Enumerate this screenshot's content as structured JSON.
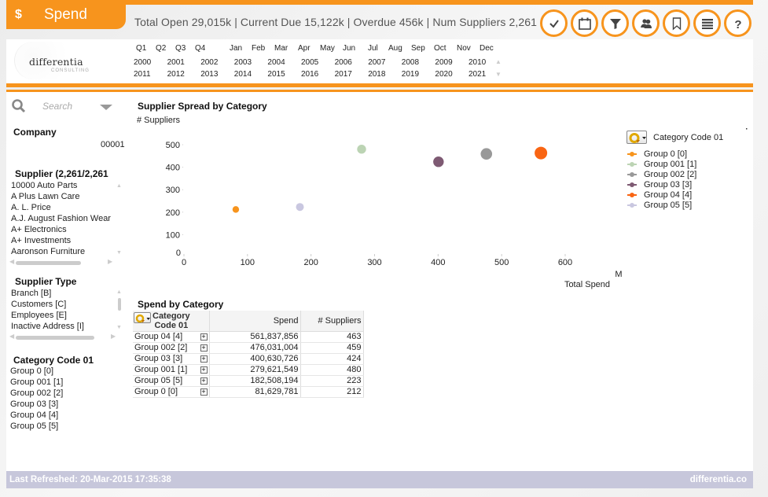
{
  "header": {
    "app_icon": "$",
    "app_title": "Spend",
    "kpi_text": "Total Open 29,015k | Current Due 15,122k | Overdue 456k | Num Suppliers 2,261",
    "toolbar": [
      {
        "icon": "check-icon",
        "label": "Confirm"
      },
      {
        "icon": "calendar-icon",
        "label": "Calendar"
      },
      {
        "icon": "filter-icon",
        "label": "Filter"
      },
      {
        "icon": "users-icon",
        "label": "Users"
      },
      {
        "icon": "bookmark-icon",
        "label": "Bookmark"
      },
      {
        "icon": "menu-icon",
        "label": "Menu"
      },
      {
        "icon": "help-icon",
        "label": "Help"
      }
    ],
    "accent_color": "#f7941d"
  },
  "logo": {
    "name": "differentia",
    "sub": "CONSULTING"
  },
  "date_filter": {
    "quarters": [
      "Q1",
      "Q2",
      "Q3",
      "Q4"
    ],
    "months": [
      "Jan",
      "Feb",
      "Mar",
      "Apr",
      "May",
      "Jun",
      "Jul",
      "Aug",
      "Sep",
      "Oct",
      "Nov",
      "Dec"
    ],
    "years_row1": [
      "2000",
      "2001",
      "2002",
      "2003",
      "2004",
      "2005",
      "2006",
      "2007",
      "2008",
      "2009",
      "2010"
    ],
    "years_row2": [
      "2011",
      "2012",
      "2013",
      "2014",
      "2015",
      "2016",
      "2017",
      "2018",
      "2019",
      "2020",
      "2021"
    ]
  },
  "sidebar": {
    "search_placeholder": "Search",
    "company": {
      "title": "Company",
      "value": "00001"
    },
    "supplier": {
      "title": "Supplier (2,261/2,261",
      "items": [
        "10000 Auto Parts",
        "A Plus Lawn Care",
        "A. L. Price",
        "A.J. August Fashion Wear",
        "A+ Electronics",
        "A+ Investments",
        "Aaronson Furniture"
      ]
    },
    "supplier_type": {
      "title": "Supplier Type",
      "items": [
        "Branch [B]",
        "Customers [C]",
        "Employees [E]",
        "Inactive  Address [I]"
      ]
    },
    "category_code": {
      "title": "Category Code 01",
      "items": [
        "Group 0 [0]",
        "Group 001 [1]",
        "Group 002 [2]",
        "Group 03 [3]",
        "Group 04 [4]",
        "Group 05 [5]"
      ]
    }
  },
  "chart_data": {
    "type": "scatter",
    "title": "Supplier Spread by Category",
    "ylabel": "# Suppliers",
    "xlabel": "Total Spend",
    "x_unit": "M",
    "xlim": [
      0,
      600
    ],
    "ylim": [
      0,
      500
    ],
    "x_ticks": [
      0,
      100,
      200,
      300,
      400,
      500,
      600
    ],
    "y_ticks": [
      0,
      100,
      200,
      300,
      400,
      500
    ],
    "grid": false,
    "legend_title": "Category Code 01",
    "legend_position": "right",
    "series": [
      {
        "name": "Group 0 [0]",
        "x": 81.6,
        "y": 212,
        "color": "#f7941d"
      },
      {
        "name": "Group 001 [1]",
        "x": 279.6,
        "y": 480,
        "color": "#bcd4b4"
      },
      {
        "name": "Group 002 [2]",
        "x": 476.0,
        "y": 459,
        "color": "#999999"
      },
      {
        "name": "Group 03 [3]",
        "x": 400.6,
        "y": 424,
        "color": "#7e5a73"
      },
      {
        "name": "Group 04 [4]",
        "x": 561.8,
        "y": 463,
        "color": "#f96513"
      },
      {
        "name": "Group 05 [5]",
        "x": 182.5,
        "y": 223,
        "color": "#c9c7e0"
      }
    ]
  },
  "table": {
    "title": "Spend by Category",
    "headers": {
      "category": "Category Code 01",
      "category_line1": "Category",
      "category_line2": "Code 01",
      "spend": "Spend",
      "suppliers": "# Suppliers"
    },
    "rows": [
      {
        "category": "Group 04 [4]",
        "spend": "561,837,856",
        "suppliers": "463"
      },
      {
        "category": "Group 002 [2]",
        "spend": "476,031,004",
        "suppliers": "459"
      },
      {
        "category": "Group 03 [3]",
        "spend": "400,630,726",
        "suppliers": "424"
      },
      {
        "category": "Group 001 [1]",
        "spend": "279,621,549",
        "suppliers": "480"
      },
      {
        "category": "Group 05 [5]",
        "spend": "182,508,194",
        "suppliers": "223"
      },
      {
        "category": "Group 0 [0]",
        "spend": "81,629,781",
        "suppliers": "212"
      }
    ]
  },
  "footer": {
    "last_refreshed": "Last Refreshed: 20-Mar-2015 17:35:38",
    "brand": "differentia.co"
  }
}
